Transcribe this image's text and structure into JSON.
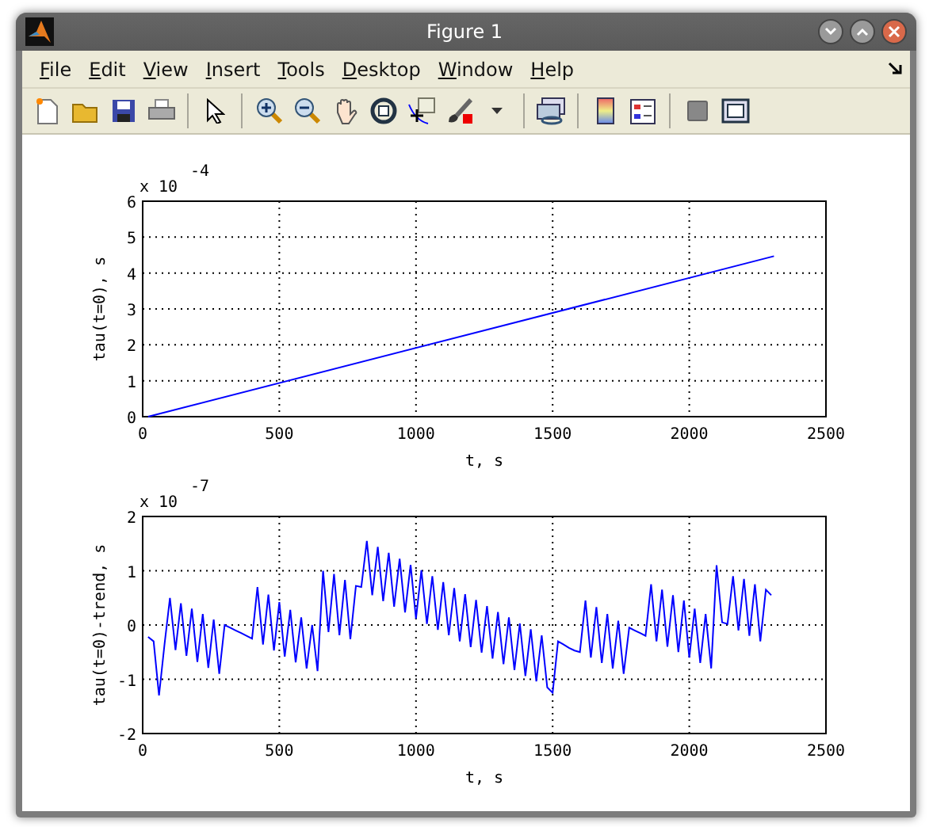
{
  "window": {
    "title": "Figure 1"
  },
  "menu": [
    {
      "label": "File"
    },
    {
      "label": "Edit"
    },
    {
      "label": "View"
    },
    {
      "label": "Insert"
    },
    {
      "label": "Tools"
    },
    {
      "label": "Desktop"
    },
    {
      "label": "Window"
    },
    {
      "label": "Help"
    }
  ],
  "toolbar": [
    {
      "kind": "new"
    },
    {
      "kind": "open"
    },
    {
      "kind": "save"
    },
    {
      "kind": "print"
    },
    {
      "kind": "sep"
    },
    {
      "kind": "pointer"
    },
    {
      "kind": "sep"
    },
    {
      "kind": "zoomin"
    },
    {
      "kind": "zoomout"
    },
    {
      "kind": "pan"
    },
    {
      "kind": "rotate"
    },
    {
      "kind": "cursor"
    },
    {
      "kind": "brush"
    },
    {
      "kind": "caret"
    },
    {
      "kind": "sep"
    },
    {
      "kind": "link"
    },
    {
      "kind": "sep"
    },
    {
      "kind": "colorbar"
    },
    {
      "kind": "legend"
    },
    {
      "kind": "sep"
    },
    {
      "kind": "hide"
    },
    {
      "kind": "show"
    }
  ],
  "plots": [
    {
      "multiplier": "x 10",
      "exponent": "-4",
      "chart_data": {
        "type": "line",
        "xlabel": "t, s",
        "ylabel": "tau(t=0), s",
        "xlim": [
          0,
          2500
        ],
        "ylim": [
          0,
          6
        ],
        "xticks": [
          0,
          500,
          1000,
          1500,
          2000,
          2500
        ],
        "yticks": [
          0,
          1,
          2,
          3,
          4,
          5,
          6
        ],
        "grid": true,
        "series": [
          {
            "color": "#0000ff",
            "x": [
              20,
              2310
            ],
            "values": [
              0,
              4.47
            ]
          }
        ]
      }
    },
    {
      "multiplier": "x 10",
      "exponent": "-7",
      "chart_data": {
        "type": "line",
        "xlabel": "t, s",
        "ylabel": "tau(t=0)-trend, s",
        "xlim": [
          0,
          2500
        ],
        "ylim": [
          -2,
          2
        ],
        "xticks": [
          0,
          500,
          1000,
          1500,
          2000,
          2500
        ],
        "yticks": [
          -2,
          -1,
          0,
          1,
          2
        ],
        "grid": true,
        "series": [
          {
            "color": "#0000ff",
            "x": [
              20,
              40,
              60,
              80,
              100,
              120,
              140,
              160,
              180,
              200,
              220,
              240,
              260,
              280,
              300,
              320,
              340,
              360,
              380,
              400,
              420,
              440,
              460,
              480,
              500,
              520,
              540,
              560,
              580,
              600,
              620,
              640,
              660,
              680,
              700,
              720,
              740,
              760,
              780,
              800,
              820,
              840,
              860,
              880,
              900,
              920,
              940,
              960,
              980,
              1000,
              1020,
              1040,
              1060,
              1080,
              1100,
              1120,
              1140,
              1160,
              1180,
              1200,
              1220,
              1240,
              1260,
              1280,
              1300,
              1320,
              1340,
              1360,
              1380,
              1400,
              1420,
              1440,
              1460,
              1480,
              1500,
              1520,
              1540,
              1560,
              1580,
              1600,
              1620,
              1640,
              1660,
              1680,
              1700,
              1720,
              1740,
              1760,
              1780,
              1800,
              1820,
              1840,
              1860,
              1880,
              1900,
              1920,
              1940,
              1960,
              1980,
              2000,
              2020,
              2040,
              2060,
              2080,
              2100,
              2120,
              2140,
              2160,
              2180,
              2200,
              2220,
              2240,
              2260,
              2280,
              2300
            ],
            "values": [
              -0.22,
              -0.3,
              -1.3,
              -0.35,
              0.5,
              -0.46,
              0.4,
              -0.57,
              0.3,
              -0.68,
              0.2,
              -0.79,
              0.1,
              -0.9,
              0.0,
              -0.05,
              -0.1,
              -0.15,
              -0.2,
              -0.25,
              0.7,
              -0.36,
              0.56,
              -0.47,
              0.42,
              -0.58,
              0.28,
              -0.69,
              0.14,
              -0.8,
              0.0,
              -0.85,
              1.0,
              -0.13,
              0.94,
              -0.19,
              0.83,
              -0.26,
              0.72,
              0.7,
              1.55,
              0.55,
              1.44,
              0.44,
              1.33,
              0.34,
              1.22,
              0.23,
              1.11,
              0.12,
              1.01,
              0.02,
              0.9,
              -0.09,
              0.79,
              -0.19,
              0.68,
              -0.3,
              0.57,
              -0.41,
              0.46,
              -0.51,
              0.35,
              -0.62,
              0.24,
              -0.72,
              0.14,
              -0.83,
              0.03,
              -0.94,
              -0.08,
              -1.04,
              -0.19,
              -1.15,
              -1.25,
              -0.3,
              -0.36,
              -0.42,
              -0.47,
              -0.5,
              0.45,
              -0.6,
              0.33,
              -0.7,
              0.2,
              -0.8,
              0.08,
              -0.9,
              -0.05,
              -0.1,
              -0.15,
              -0.2,
              0.75,
              -0.3,
              0.65,
              -0.4,
              0.55,
              -0.5,
              0.45,
              -0.6,
              0.3,
              -0.7,
              0.2,
              -0.8,
              1.1,
              0.05,
              0.02,
              0.9,
              -0.1,
              0.85,
              -0.2,
              0.75,
              -0.3,
              0.65,
              0.55
            ]
          }
        ]
      }
    }
  ]
}
